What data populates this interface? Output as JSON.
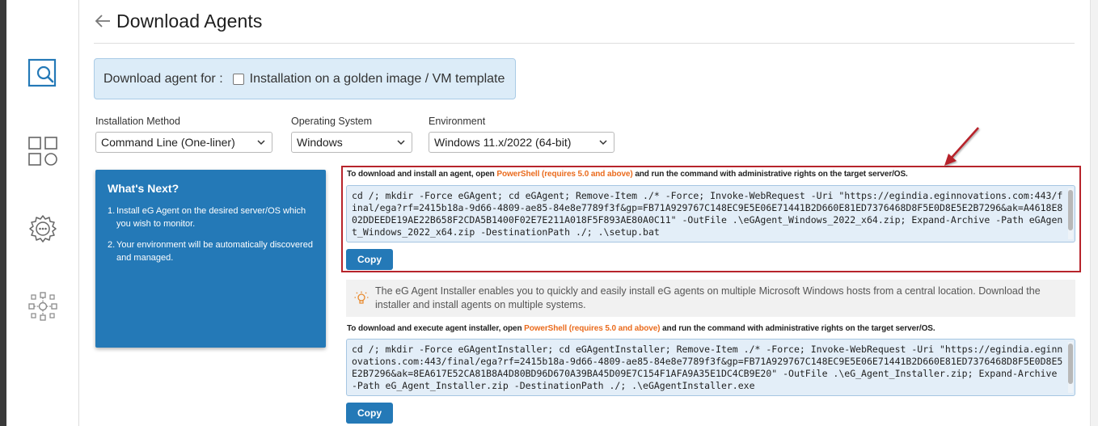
{
  "page": {
    "title": "Download Agents"
  },
  "golden_image": {
    "prefix": "Download agent for :",
    "checkbox_label": "Installation on a golden image / VM template",
    "checked": false
  },
  "selectors": {
    "installation_method": {
      "label": "Installation Method",
      "value": "Command Line (One-liner)"
    },
    "operating_system": {
      "label": "Operating System",
      "value": "Windows"
    },
    "environment": {
      "label": "Environment",
      "value": "Windows 11.x/2022 (64-bit)"
    }
  },
  "whats_next": {
    "title": "What's Next?",
    "items": [
      {
        "num": "1.",
        "text": "Install eG Agent on the desired server/OS which you wish to monitor."
      },
      {
        "num": "2.",
        "text": "Your environment will be automatically discovered and managed."
      }
    ]
  },
  "agent_command": {
    "instruction_prefix": "To download and install an agent, open",
    "powershell": "PowerShell",
    "requirement": "(requires 5.0 and above)",
    "instruction_suffix": "and run the command with administrative rights on the target server/OS.",
    "command": "cd /; mkdir -Force eGAgent; cd eGAgent; Remove-Item ./* -Force; Invoke-WebRequest -Uri \"https://egindia.eginnovations.com:443/final/ega?rf=2415b18a-9d66-4809-ae85-84e8e7789f3f&gp=FB71A929767C148EC9E5E06E71441B2D660E81ED7376468D8F5E0D8E5E2B7296&ak=A4618E802DDEEDE19AE22B658F2CDA5B1400F02E7E211A018F5F893AE80A0C11\" -OutFile .\\eGAgent_Windows_2022_x64.zip; Expand-Archive -Path eGAgent_Windows_2022_x64.zip -DestinationPath ./; .\\setup.bat",
    "copy_label": "Copy"
  },
  "installer_info": {
    "text": "The eG Agent Installer enables you to quickly and easily install eG agents on multiple Microsoft Windows hosts from a central location. Download the installer and install agents on multiple systems."
  },
  "installer_command": {
    "instruction_prefix": "To download and execute agent installer, open",
    "powershell": "PowerShell",
    "requirement": "(requires 5.0 and above)",
    "instruction_suffix": "and run the command with administrative rights on the target server/OS.",
    "command": "cd /; mkdir -Force eGAgentInstaller; cd eGAgentInstaller; Remove-Item ./* -Force; Invoke-WebRequest -Uri \"https://egindia.eginnovations.com:443/final/ega?rf=2415b18a-9d66-4809-ae85-84e8e7789f3f&gp=FB71A929767C148EC9E5E06E71441B2D660E81ED7376468D8F5E0D8E5E2B7296&ak=8EA617E52CA81B8A4D80BD96D670A39BA45D09E7C154F1AFA9A35E1DC4CB9E20\" -OutFile .\\eG_Agent_Installer.zip; Expand-Archive -Path eG_Agent_Installer.zip -DestinationPath ./; .\\eGAgentInstaller.exe",
    "copy_label": "Copy"
  },
  "colors": {
    "accent_blue": "#2479b7",
    "powershell_orange": "#ea6b1d",
    "highlight_red": "#b7242b"
  },
  "icons": {
    "rail": [
      "search-monitor-icon",
      "grid-apps-icon",
      "gear-settings-icon",
      "network-topology-icon"
    ],
    "back": "arrow-left-icon",
    "info": "lightbulb-icon"
  }
}
